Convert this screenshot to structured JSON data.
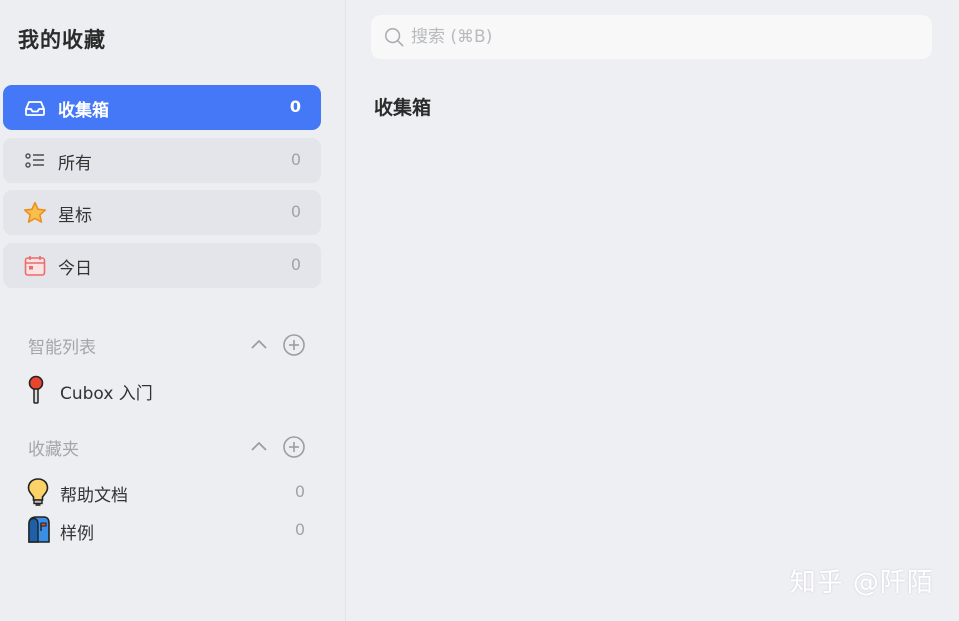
{
  "sidebar": {
    "title": "我的收藏",
    "nav": [
      {
        "label": "收集箱",
        "count": "0",
        "icon": "inbox-icon"
      },
      {
        "label": "所有",
        "count": "0",
        "icon": "list-icon"
      },
      {
        "label": "星标",
        "count": "0",
        "icon": "star-icon"
      },
      {
        "label": "今日",
        "count": "0",
        "icon": "calendar-icon"
      }
    ],
    "smart_lists": {
      "heading": "智能列表",
      "items": [
        {
          "label": "Cubox 入门",
          "icon": "pushpin-icon"
        }
      ]
    },
    "folders": {
      "heading": "收藏夹",
      "items": [
        {
          "label": "帮助文档",
          "count": "0",
          "icon": "lightbulb-icon"
        },
        {
          "label": "样例",
          "count": "0",
          "icon": "mailbox-icon"
        }
      ]
    }
  },
  "search": {
    "placeholder": "搜索 (⌘B)"
  },
  "main": {
    "title": "收集箱"
  },
  "watermark": "知乎 @阡陌",
  "colors": {
    "accent": "#4478f6",
    "sidebar_bg": "#edeef2",
    "main_bg": "#eeeff3"
  }
}
